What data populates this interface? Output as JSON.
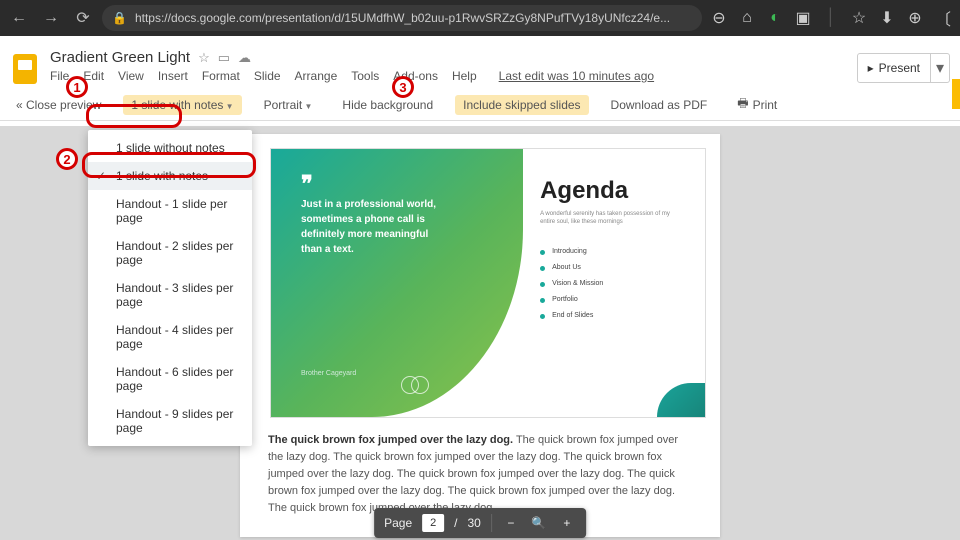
{
  "browser": {
    "url": "https://docs.google.com/presentation/d/15UMdfhW_b02uu-p1RwvSRZzGy8NPufTVy18yUNfcz24/e..."
  },
  "doc": {
    "title": "Gradient Green Light",
    "menu": [
      "File",
      "Edit",
      "View",
      "Insert",
      "Format",
      "Slide",
      "Arrange",
      "Tools",
      "Add-ons",
      "Help"
    ],
    "last_edit": "Last edit was 10 minutes ago",
    "present": "Present"
  },
  "toolbar": {
    "close_preview": "« Close preview",
    "layout_dropdown": "1 slide with notes",
    "orientation": "Portrait",
    "hide_bg": "Hide background",
    "include_skipped": "Include skipped slides",
    "download_pdf": "Download as PDF",
    "print": "Print"
  },
  "dropdown": {
    "items": [
      "1 slide without notes",
      "1 slide with notes",
      "Handout - 1 slide per page",
      "Handout - 2 slides per page",
      "Handout - 3 slides per page",
      "Handout - 4 slides per page",
      "Handout - 6 slides per page",
      "Handout - 9 slides per page"
    ],
    "selected_index": 1
  },
  "slide": {
    "quote": "Just in a professional world, sometimes a phone call is definitely more meaningful than a text.",
    "quote_sub": "Brother Cageyard",
    "agenda_title": "Agenda",
    "agenda_sub": "A wonderful serenity has taken possession of my entire soul, like these mornings",
    "agenda_items": [
      "Introducing",
      "About Us",
      "Vision & Mission",
      "Portfolio",
      "End of Slides"
    ]
  },
  "notes": {
    "bold": "The quick brown fox jumped over the lazy dog.",
    "body": " The quick brown fox jumped over the lazy dog. The quick brown fox jumped over the lazy dog. The quick brown fox jumped over the lazy dog. The quick brown fox jumped over the lazy dog. The quick brown fox jumped over the lazy dog. The quick brown fox jumped over the lazy dog. The quick brown fox jumped over the lazy dog."
  },
  "pagenav": {
    "label": "Page",
    "current": "2",
    "sep": "/",
    "total": "30"
  },
  "callouts": {
    "c1": "1",
    "c2": "2",
    "c3": "3"
  }
}
